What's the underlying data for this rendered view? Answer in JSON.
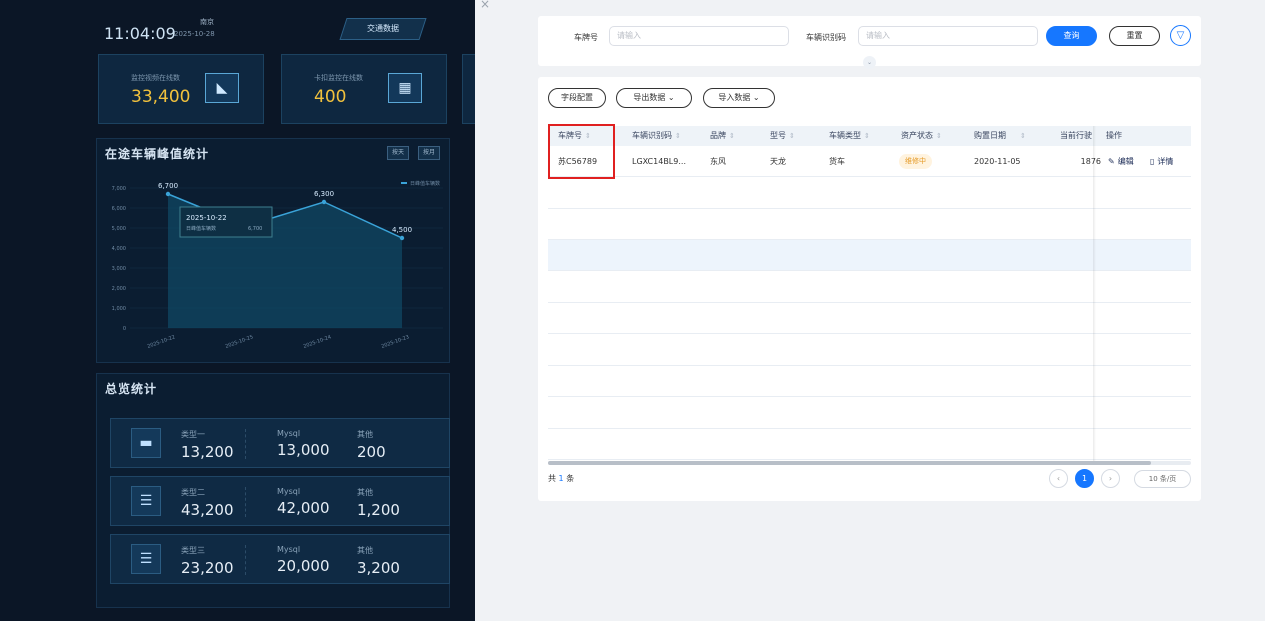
{
  "dashboard": {
    "time": "11:04:09",
    "date": "2025-10-28",
    "city": "南京",
    "tab": "交通数据",
    "kpis": [
      {
        "label": "监控视频在线数",
        "value": "33,400"
      },
      {
        "label": "卡扣监控在线数",
        "value": "400"
      }
    ],
    "peak_title": "在途车辆峰值统计",
    "peak_pills": [
      "按天",
      "按月"
    ],
    "tooltip": {
      "date": "2025-10-22",
      "series": "日峰值车辆数",
      "value": "6,700"
    },
    "overview_title": "总览统计",
    "overview_rows": [
      {
        "type": "类型一",
        "type_val": "13,200",
        "db": "Mysql",
        "db_val": "13,000",
        "other": "其他",
        "other_val": "200"
      },
      {
        "type": "类型二",
        "type_val": "43,200",
        "db": "Mysql",
        "db_val": "42,000",
        "other": "其他",
        "other_val": "1,200"
      },
      {
        "type": "类型三",
        "type_val": "23,200",
        "db": "Mysql",
        "db_val": "20,000",
        "other": "其他",
        "other_val": "3,200"
      }
    ]
  },
  "chart_data": {
    "type": "area",
    "title": "在途车辆峰值统计",
    "categories": [
      "2025-10-22",
      "2025-10-25",
      "2025-10-24",
      "2025-10-23"
    ],
    "series": [
      {
        "name": "日峰值车辆数",
        "values": [
          6700,
          5100,
          6300,
          4500
        ]
      }
    ],
    "data_labels": [
      "6,700",
      "6,300",
      "4,500"
    ],
    "y_ticks": [
      "0",
      "1,000",
      "2,000",
      "3,000",
      "4,000",
      "5,000",
      "6,000",
      "7,000"
    ],
    "ylim": [
      0,
      7000
    ],
    "grid": true,
    "legend": "top-right",
    "colors": {
      "line": "#3aa3d8",
      "fill": "#0f4a66"
    }
  },
  "close_glyph": "×",
  "filter": {
    "plate_label": "车牌号",
    "plate_placeholder": "请输入",
    "vin_label": "车辆识别码",
    "vin_placeholder": "请输入",
    "query_btn": "查询",
    "reset_btn": "重置",
    "filter_icon": "funnel-icon"
  },
  "toolbar": {
    "field_config": "字段配置",
    "export": "导出数据",
    "import": "导入数据"
  },
  "table": {
    "columns": [
      "车牌号",
      "车辆识别码",
      "品牌",
      "型号",
      "车辆类型",
      "资产状态",
      "购置日期",
      "当前行驶",
      "操作"
    ],
    "rows": [
      {
        "plate": "苏C56789",
        "vin": "LGXC14BL9...",
        "brand": "东风",
        "model": "天龙",
        "vtype": "货车",
        "status": "维修中",
        "date": "2020-11-05",
        "mileage": "1876",
        "edit": "编辑",
        "detail": "详情"
      }
    ]
  },
  "footer": {
    "total_prefix": "共",
    "total_count": "1",
    "total_suffix": "条",
    "current_page": "1",
    "page_size": "10 条/页"
  },
  "accent": "#1677ff",
  "status_color": "#e59a26",
  "highlight": "#e02020"
}
